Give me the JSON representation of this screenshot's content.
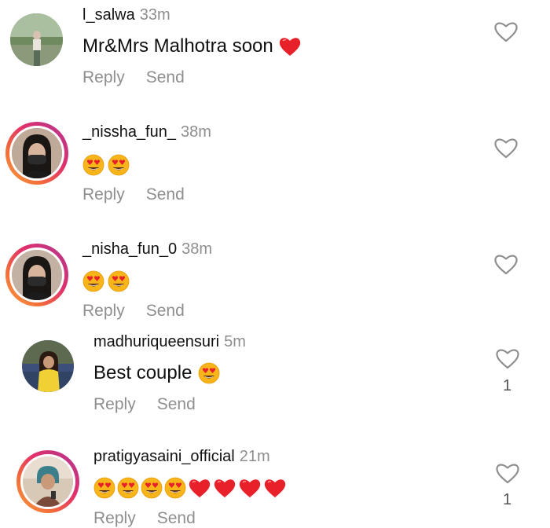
{
  "actions": {
    "reply_label": "Reply",
    "send_label": "Send"
  },
  "icons": {
    "like": "heart-outline-icon",
    "heart_emoji": "red-heart-emoji",
    "smile_emoji": "heart-eyes-emoji"
  },
  "comments": [
    {
      "username": "l_salwa",
      "time": "33m",
      "text": "Mr&Mrs Malhotra soon",
      "like_count": ""
    },
    {
      "username": "_nissha_fun_",
      "time": "38m",
      "text": "",
      "like_count": ""
    },
    {
      "username": "_nisha_fun_0",
      "time": "38m",
      "text": "",
      "like_count": ""
    },
    {
      "username": "madhuriqueensuri",
      "time": "5m",
      "text": "Best couple",
      "like_count": "1"
    },
    {
      "username": "pratigyasaini_official",
      "time": "21m",
      "text": "",
      "like_count": "1"
    }
  ],
  "colors": {
    "text": "#111111",
    "muted": "#8e8e8e",
    "heart": "#e8202a",
    "emoji_face": "#f7b500"
  }
}
